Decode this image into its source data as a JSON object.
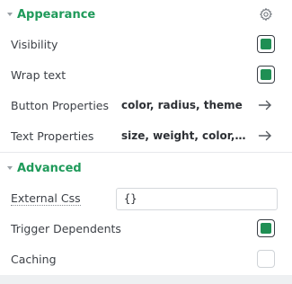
{
  "appearance": {
    "title": "Appearance",
    "settings_icon": "gear-icon",
    "rows": {
      "visibility": {
        "label": "Visibility",
        "checked": true
      },
      "wrap_text": {
        "label": "Wrap text",
        "checked": true
      },
      "button_properties": {
        "label": "Button Properties",
        "value": "color, radius, theme",
        "icon": "arrow-right-icon"
      },
      "text_properties": {
        "label": "Text Properties",
        "value": "size, weight, color, ali...",
        "icon": "arrow-right-icon"
      }
    }
  },
  "advanced": {
    "title": "Advanced",
    "rows": {
      "external_css": {
        "label": "External Css",
        "value": "{}"
      },
      "trigger_dependents": {
        "label": "Trigger Dependents",
        "checked": true
      },
      "caching": {
        "label": "Caching",
        "checked": false
      }
    }
  },
  "colors": {
    "accent": "#1f9a5a",
    "checkbox_fill": "#1f8f54"
  }
}
